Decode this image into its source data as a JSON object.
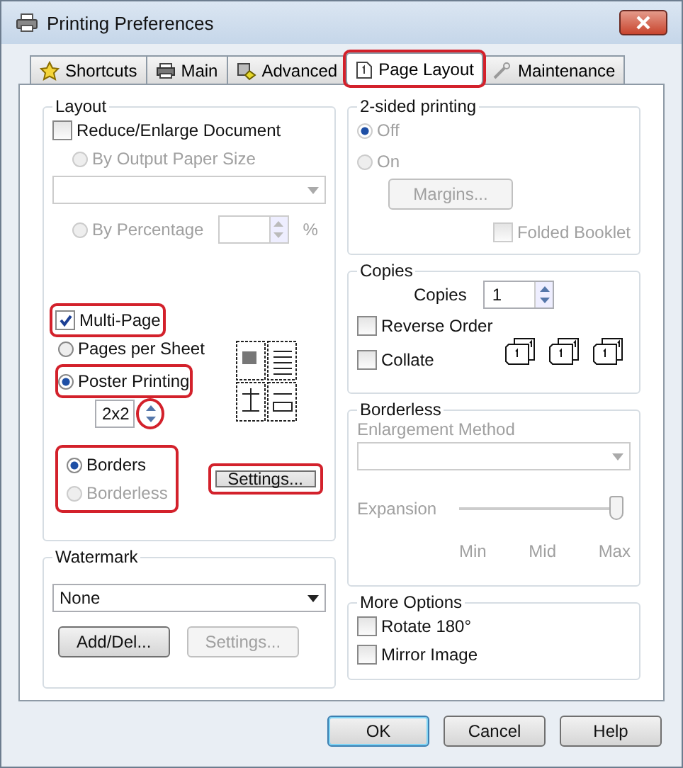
{
  "window": {
    "title": "Printing Preferences"
  },
  "tabs": [
    {
      "label": "Shortcuts",
      "selected": false,
      "highlighted": false
    },
    {
      "label": "Main",
      "selected": false,
      "highlighted": false
    },
    {
      "label": "Advanced",
      "selected": false,
      "highlighted": false
    },
    {
      "label": "Page Layout",
      "selected": true,
      "highlighted": true
    },
    {
      "label": "Maintenance",
      "selected": false,
      "highlighted": false
    }
  ],
  "layout": {
    "title": "Layout",
    "reduce_enlarge": {
      "label": "Reduce/Enlarge Document",
      "checked": false,
      "disabled": false
    },
    "by_output_paper_size": {
      "label": "By Output Paper Size",
      "selected": false,
      "disabled": true
    },
    "by_percentage": {
      "label": "By Percentage",
      "selected": false,
      "disabled": true
    },
    "percent_unit": "%",
    "multi_page": {
      "label": "Multi-Page",
      "checked": true,
      "highlighted": true
    },
    "pages_per_sheet": {
      "label": "Pages per Sheet",
      "selected": false
    },
    "poster_printing": {
      "label": "Poster Printing",
      "selected": true,
      "highlighted": true
    },
    "poster_size": {
      "value": "2x2",
      "spinner_highlighted": true
    },
    "borders": {
      "label": "Borders",
      "selected": true,
      "disabled": false
    },
    "borderless": {
      "label": "Borderless",
      "selected": false,
      "disabled": true
    },
    "border_choice_highlighted": true,
    "settings_button": {
      "label": "Settings...",
      "highlighted": true
    }
  },
  "watermark": {
    "title": "Watermark",
    "value": "None",
    "add_del_button": "Add/Del...",
    "settings_button": {
      "label": "Settings...",
      "disabled": true
    }
  },
  "two_sided_printing": {
    "title": "2-sided printing",
    "options": [
      {
        "label": "Off",
        "selected": true,
        "disabled": true
      },
      {
        "label": "On",
        "selected": false,
        "disabled": true
      }
    ],
    "margins_button": {
      "label": "Margins...",
      "disabled": true
    },
    "folded_booklet": {
      "label": "Folded Booklet",
      "checked": false,
      "disabled": true
    }
  },
  "copies": {
    "title": "Copies",
    "label": "Copies",
    "value": "1",
    "reverse_order": {
      "label": "Reverse Order",
      "checked": false
    },
    "collate": {
      "label": "Collate",
      "checked": false
    }
  },
  "borderless": {
    "title": "Borderless",
    "enlargement_method": "Enlargement Method",
    "expansion": {
      "label": "Expansion",
      "level": 1,
      "disabled": true
    },
    "ticks": [
      "Min",
      "Mid",
      "Max"
    ]
  },
  "more_options": {
    "title": "More Options",
    "items": [
      {
        "label": "Rotate 180°",
        "checked": false
      },
      {
        "label": "Mirror Image",
        "checked": false
      }
    ]
  },
  "buttons": [
    {
      "label": "OK",
      "default": true
    },
    {
      "label": "Cancel",
      "default": false
    },
    {
      "label": "Help",
      "default": false
    }
  ]
}
